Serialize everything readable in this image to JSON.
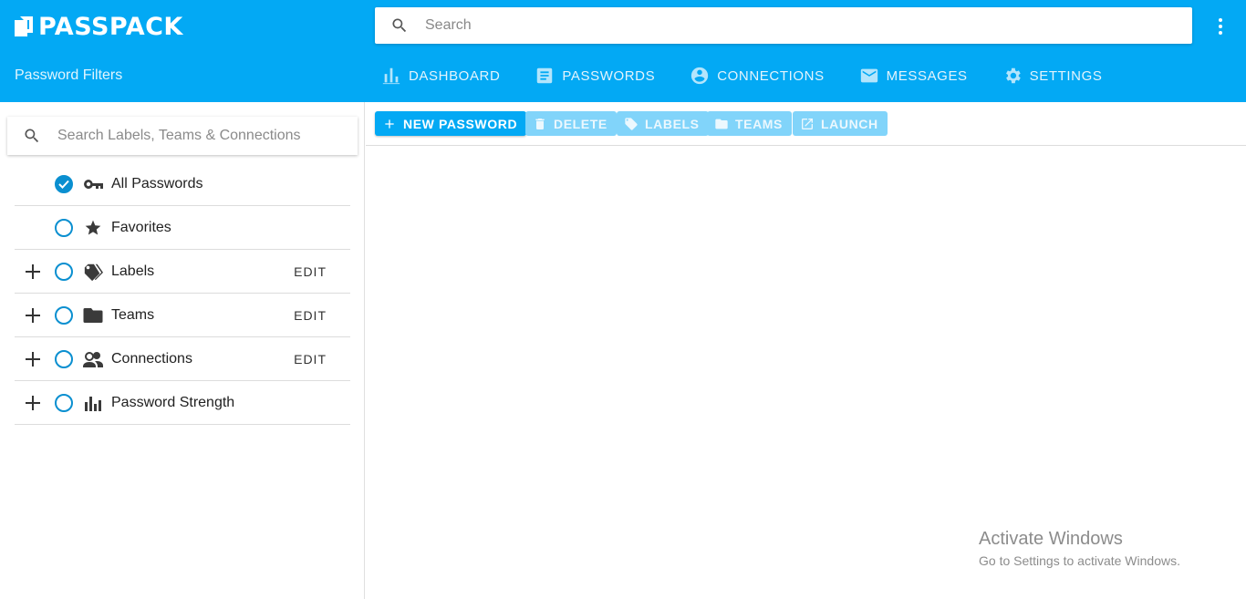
{
  "app": {
    "logo_text": "PASSPACK"
  },
  "search": {
    "placeholder": "Search"
  },
  "sidebar": {
    "title": "Password Filters",
    "search_placeholder": "Search Labels, Teams & Connections",
    "items": [
      {
        "label": "All Passwords",
        "icon": "key-icon",
        "checked": true,
        "expandable": false,
        "edit": ""
      },
      {
        "label": "Favorites",
        "icon": "star-icon",
        "checked": false,
        "expandable": false,
        "edit": ""
      },
      {
        "label": "Labels",
        "icon": "labels-icon",
        "checked": false,
        "expandable": true,
        "edit": "EDIT"
      },
      {
        "label": "Teams",
        "icon": "folder-icon",
        "checked": false,
        "expandable": true,
        "edit": "EDIT"
      },
      {
        "label": "Connections",
        "icon": "people-icon",
        "checked": false,
        "expandable": true,
        "edit": "EDIT"
      },
      {
        "label": "Password Strength",
        "icon": "bar-chart-icon",
        "checked": false,
        "expandable": true,
        "edit": ""
      }
    ]
  },
  "nav": {
    "dashboard": "DASHBOARD",
    "passwords": "PASSWORDS",
    "connections": "CONNECTIONS",
    "messages": "MESSAGES",
    "settings": "SETTINGS"
  },
  "toolbar": {
    "new_password": "NEW PASSWORD",
    "delete": "DELETE",
    "labels": "LABELS",
    "teams": "TEAMS",
    "launch": "LAUNCH"
  },
  "watermark": {
    "line1": "Activate Windows",
    "line2": "Go to Settings to activate Windows."
  },
  "colors": {
    "appbar": "#03a9f4",
    "accent": "#0a8fd0",
    "disabled_button": "#81d4fa"
  }
}
